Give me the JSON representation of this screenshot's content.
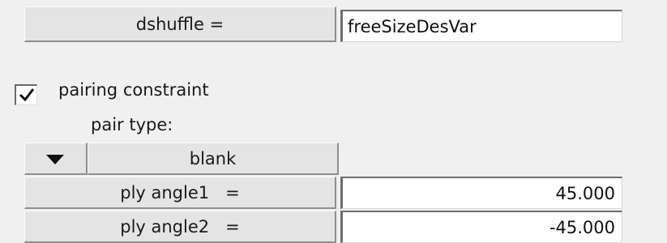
{
  "dshuffle": {
    "label": "dshuffle =",
    "value": "freeSizeDesVar"
  },
  "pairing": {
    "checked": true,
    "label": "pairing constraint",
    "pair_type_label": "pair type:",
    "pair_type_value": "blank"
  },
  "ply_angles": [
    {
      "label": "ply angle1   =",
      "value": "45.000"
    },
    {
      "label": "ply angle2   =",
      "value": "-45.000"
    }
  ],
  "icons": {
    "checkbox_mark": "check-icon",
    "dropdown_arrow": "triangle-down-icon"
  }
}
